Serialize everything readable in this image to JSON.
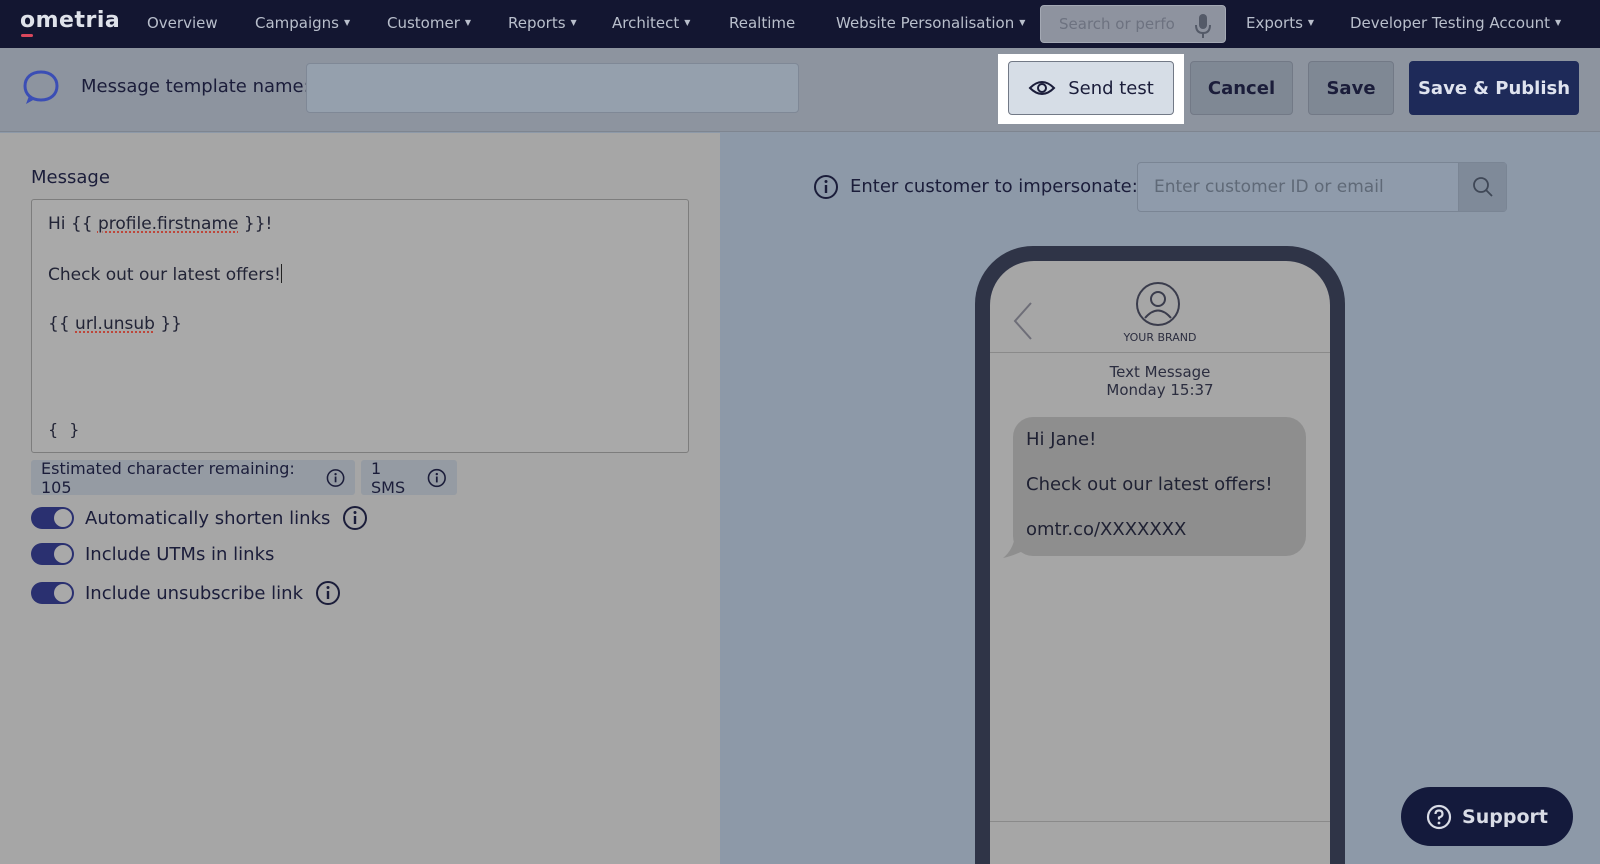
{
  "nav": {
    "logo": "ometria",
    "items": [
      {
        "label": "Overview",
        "dropdown": false
      },
      {
        "label": "Campaigns",
        "dropdown": true
      },
      {
        "label": "Customer",
        "dropdown": true
      },
      {
        "label": "Reports",
        "dropdown": true
      },
      {
        "label": "Architect",
        "dropdown": true
      },
      {
        "label": "Realtime",
        "dropdown": false
      },
      {
        "label": "Website Personalisation",
        "dropdown": true
      }
    ],
    "search_placeholder": "Search or perfo",
    "exports_label": "Exports",
    "account_label": "Developer Testing Account"
  },
  "header": {
    "template_name_label": "Message template name:",
    "template_name_value": "",
    "send_test_label": "Send test",
    "cancel_label": "Cancel",
    "save_label": "Save",
    "publish_label": "Save & Publish"
  },
  "editor": {
    "message_label": "Message",
    "lines": [
      "Hi {{ ",
      "profile.firstname",
      " }}!",
      "Check out our latest offers!",
      "{{ ",
      "url.unsub",
      " }}"
    ],
    "personalisation_icon": "{ }",
    "chars_remaining_label": "Estimated character remaining: 105",
    "sms_count_label": "1 SMS",
    "toggles": [
      {
        "label": "Automatically shorten links",
        "on": true,
        "info": true
      },
      {
        "label": "Include UTMs in links",
        "on": true,
        "info": false
      },
      {
        "label": "Include unsubscribe link",
        "on": true,
        "info": true
      }
    ]
  },
  "preview": {
    "impersonate_label": "Enter customer to impersonate:",
    "impersonate_placeholder": "Enter customer ID or email",
    "brand_name": "YOUR BRAND",
    "message_type": "Text Message",
    "message_time": "Monday 15:37",
    "bubble_lines": [
      "Hi Jane!",
      "Check out our latest offers!",
      "omtr.co/XXXXXXX"
    ]
  },
  "support_label": "Support",
  "colors": {
    "nav_bg": "#131631",
    "primary_button": "#1e2a59",
    "toggle_on": "#2a3070",
    "support_bg": "#141a3c"
  }
}
